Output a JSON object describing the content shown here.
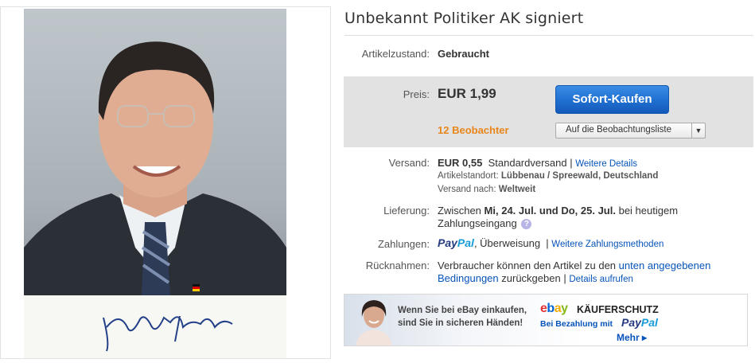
{
  "item": {
    "title": "Unbekannt Politiker AK signiert"
  },
  "condition": {
    "label": "Artikelzustand:",
    "value": "Gebraucht"
  },
  "price": {
    "label": "Preis:",
    "value": "EUR 1,99",
    "buy_label": "Sofort-Kaufen",
    "watchers": "12 Beobachter",
    "watchlist_label": "Auf die Beobachtungsliste",
    "dropdown_glyph": "▼"
  },
  "shipping": {
    "label": "Versand:",
    "cost": "EUR 0,55",
    "method": "Standardversand",
    "separator": "|",
    "more_link": "Weitere Details",
    "location_label": "Artikelstandort:",
    "location": "Lübbenau / Spreewald, Deutschland",
    "ships_to_label": "Versand nach:",
    "ships_to": "Weltweit"
  },
  "delivery": {
    "label": "Lieferung:",
    "prefix": "Zwischen",
    "range": "Mi, 24. Jul. und Do, 25. Jul.",
    "suffix": "bei heutigem",
    "line2": "Zahlungseingang",
    "help_glyph": "?"
  },
  "payments": {
    "label": "Zahlungen:",
    "paypal_pay": "Pay",
    "paypal_pal": "Pal",
    "transfer": "Überweisung",
    "separator": "|",
    "more_link": "Weitere Zahlungsmethoden"
  },
  "returns": {
    "label": "Rücknahmen:",
    "text1": "Verbraucher können den Artikel zu den",
    "link1": "unten angegebenen",
    "link2": "Bedingungen",
    "text2": "zurückgeben",
    "separator": "|",
    "details_link": "Details aufrufen"
  },
  "banner": {
    "line1": "Wenn Sie bei eBay einkaufen,",
    "line2": "sind Sie in sicheren Händen!",
    "ebay_e": "e",
    "ebay_b": "b",
    "ebay_a": "a",
    "ebay_y": "y",
    "title": "KÄUFERSCHUTZ",
    "sub": "Bei Bezahlung mit",
    "paypal_pay": "Pay",
    "paypal_pal": "Pal",
    "more": "Mehr ▸"
  },
  "colors": {
    "link": "#0654ba",
    "watchers": "#e8861b",
    "buy_button": "#1f6fd0",
    "price_box": "#e2e2e2"
  },
  "icons": [
    "help-icon",
    "dropdown-arrow-icon"
  ]
}
